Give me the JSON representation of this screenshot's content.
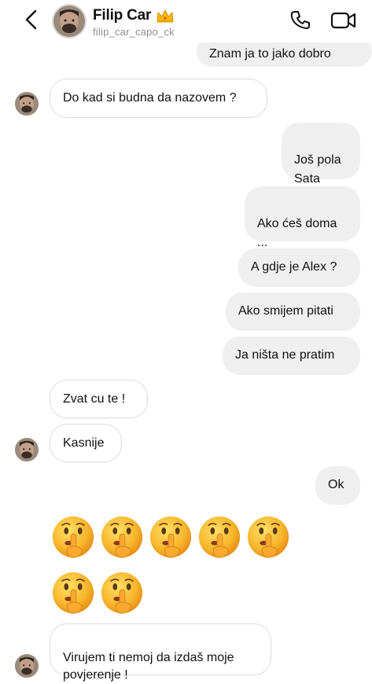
{
  "header": {
    "name": "Filip Car",
    "username": "filip_car_capo_ck"
  },
  "messages": [
    {
      "text": "Znam ja to jako dobro"
    },
    {
      "text": "Do kad si budna da nazovem ?"
    },
    {
      "text": "Još pola\nSata"
    },
    {
      "text": "Ako ćeš doma\n..."
    },
    {
      "text": "A gdje je Alex ?"
    },
    {
      "text": "Ako smijem pitati"
    },
    {
      "text": "Ja ništa ne pratim"
    },
    {
      "text": "Zvat cu te !"
    },
    {
      "text": "Kasnije"
    },
    {
      "text": "Ok"
    },
    {
      "text": "Virujem ti nemoj da izdaš moje\npovjerenje !"
    }
  ],
  "icons": {
    "back": "chevron-left-icon",
    "crown": "crown-emoji-icon",
    "call": "phone-icon",
    "video": "video-camera-icon",
    "emoji": "shushing-face-emoji"
  },
  "colors": {
    "outgoing_bubble": "#efefef",
    "incoming_bubble": "#ffffff",
    "incoming_border": "#dbdbdb",
    "username": "#8e8e8e"
  }
}
